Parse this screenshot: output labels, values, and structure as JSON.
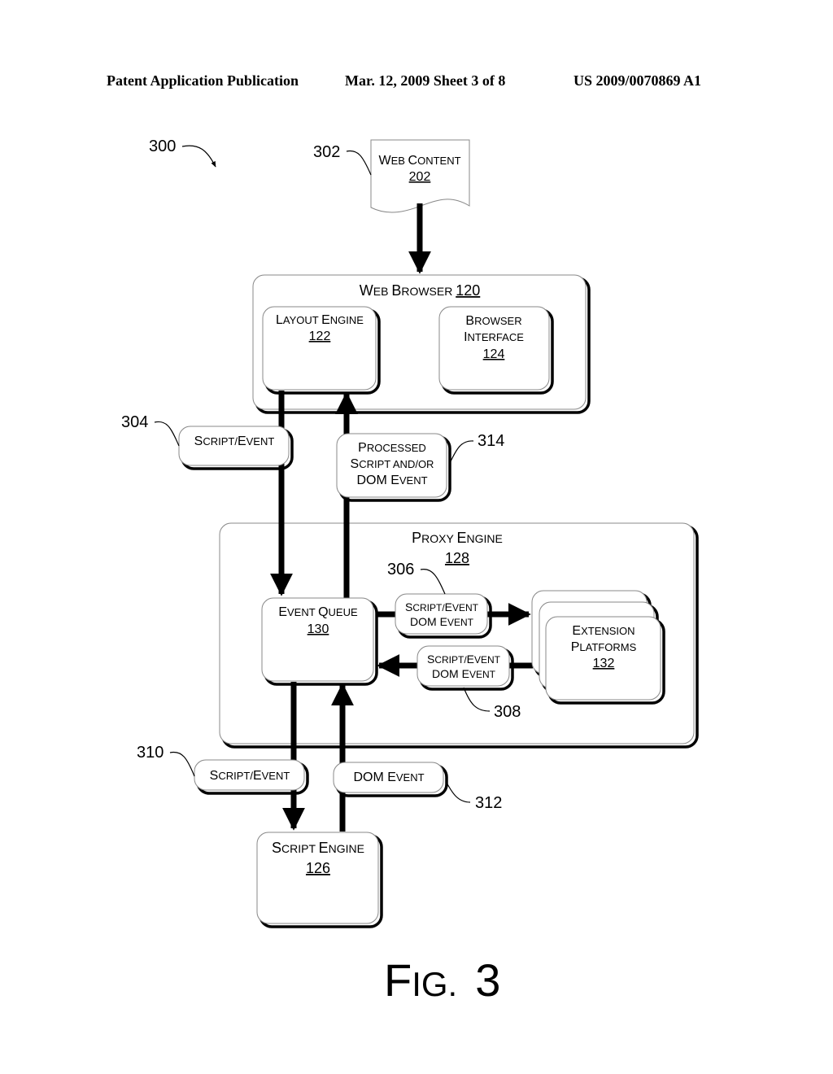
{
  "header": {
    "left": "Patent Application Publication",
    "center": "Mar. 12, 2009  Sheet 3 of 8",
    "right": "US 2009/0070869 A1"
  },
  "figure": {
    "ref": "300",
    "caption_prefix": "F",
    "caption_small": "IG.",
    "caption_num": "3"
  },
  "nodes": {
    "web_content": {
      "ref": "302",
      "label_caps": [
        "W",
        "EB ",
        "C",
        "ONTENT"
      ],
      "num": "202"
    },
    "web_browser": {
      "label_caps": [
        "W",
        "EB ",
        "B",
        "ROWSER "
      ],
      "num": "120"
    },
    "layout_engine": {
      "label_caps": [
        "L",
        "AYOUT ",
        "E",
        "NGINE"
      ],
      "num": "122"
    },
    "browser_interface": {
      "line1_caps": [
        "B",
        "ROWSER"
      ],
      "line2_caps": [
        "I",
        "NTERFACE"
      ],
      "num": "124"
    },
    "proxy_engine": {
      "label_caps": [
        "P",
        "ROXY ",
        "E",
        "NGINE"
      ],
      "num": "128"
    },
    "event_queue": {
      "label_caps": [
        "E",
        "VENT ",
        "Q",
        "UEUE"
      ],
      "num": "130"
    },
    "extension_platforms": {
      "line1_caps": [
        "E",
        "XTENSION"
      ],
      "line2_caps": [
        "P",
        "LATFORMS"
      ],
      "num": "132"
    },
    "script_engine": {
      "label_caps": [
        "S",
        "CRIPT ",
        "E",
        "NGINE"
      ],
      "num": "126"
    }
  },
  "messages": {
    "m304": {
      "ref": "304",
      "line1": [
        "S",
        "CRIPT/",
        "E",
        "VENT"
      ]
    },
    "m314": {
      "ref": "314",
      "line1": [
        "P",
        "ROCESSED"
      ],
      "line2": [
        "S",
        "CRIPT AND/OR"
      ],
      "line3": [
        "DOM E",
        "VENT"
      ]
    },
    "m306": {
      "ref": "306",
      "line1": [
        "S",
        "CRIPT/",
        "E",
        "VENT"
      ],
      "line2": [
        "DOM E",
        "VENT"
      ]
    },
    "m308": {
      "ref": "308",
      "line1": [
        "S",
        "CRIPT/",
        "E",
        "VENT"
      ],
      "line2": [
        "DOM E",
        "VENT"
      ]
    },
    "m310": {
      "ref": "310",
      "line1": [
        "S",
        "CRIPT/",
        "E",
        "VENT"
      ]
    },
    "m312": {
      "ref": "312",
      "line1": [
        "DOM E",
        "VENT"
      ]
    }
  }
}
